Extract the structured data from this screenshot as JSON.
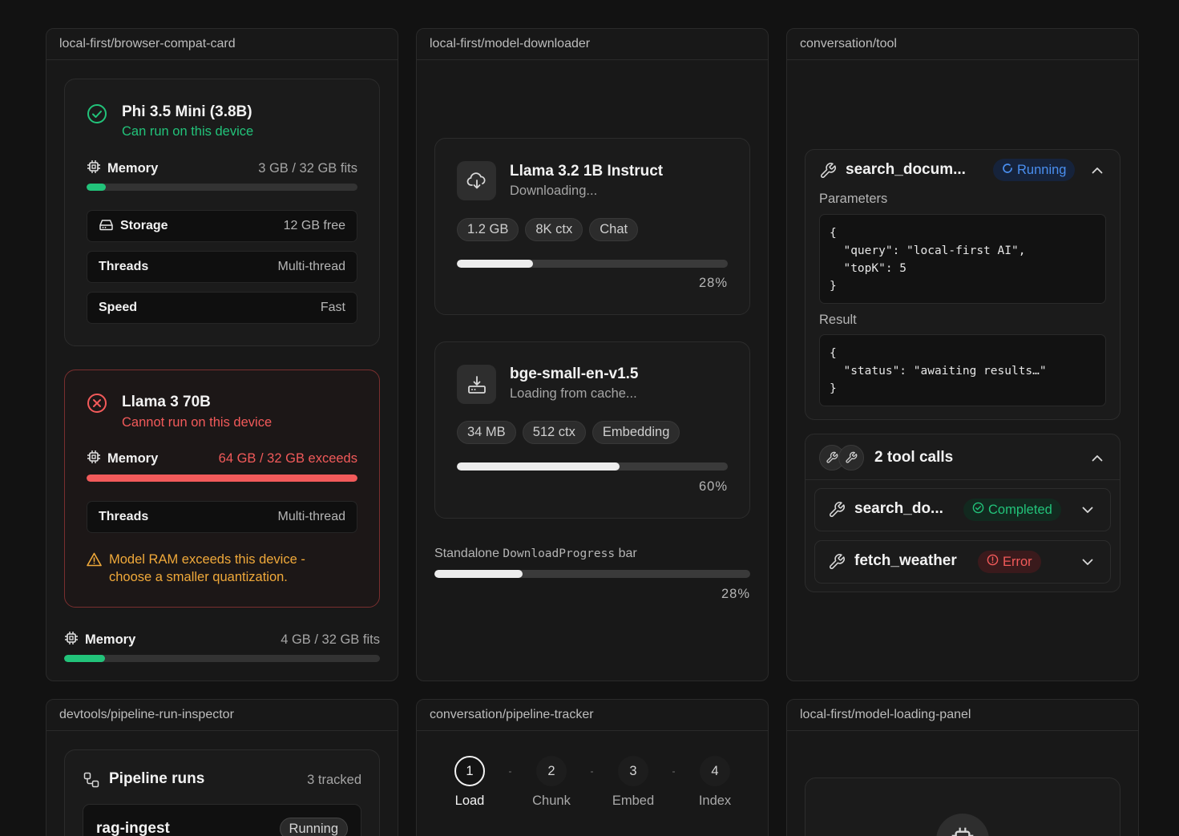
{
  "panels": {
    "compat": {
      "title": "local-first/browser-compat-card"
    },
    "downloader": {
      "title": "local-first/model-downloader"
    },
    "tool": {
      "title": "conversation/tool"
    },
    "pipeline_inspector": {
      "title": "devtools/pipeline-run-inspector"
    },
    "pipeline_tracker": {
      "title": "conversation/pipeline-tracker"
    },
    "loading_panel": {
      "title": "local-first/model-loading-panel"
    }
  },
  "compat_cards": [
    {
      "name": "Phi 3.5 Mini (3.8B)",
      "status": "Can run on this device",
      "memory_label": "Memory",
      "memory_value": "3 GB / 32 GB fits",
      "memory_fraction": 0.07,
      "rows": [
        {
          "label": "Storage",
          "value": "12 GB free"
        },
        {
          "label": "Threads",
          "value": "Multi-thread"
        },
        {
          "label": "Speed",
          "value": "Fast"
        }
      ]
    },
    {
      "name": "Llama 3 70B",
      "status": "Cannot run on this device",
      "memory_label": "Memory",
      "memory_value": "64 GB / 32 GB exceeds",
      "memory_fraction": 1.0,
      "rows": [
        {
          "label": "Threads",
          "value": "Multi-thread"
        }
      ],
      "warning": "Model RAM exceeds this device - choose a smaller quantization."
    }
  ],
  "standalone_memory": {
    "label": "Memory",
    "value": "4 GB / 32 GB fits",
    "fraction": 0.13
  },
  "downloads": [
    {
      "name": "Llama 3.2 1B Instruct",
      "status": "Downloading...",
      "tags": [
        "1.2 GB",
        "8K ctx",
        "Chat"
      ],
      "progress": 28,
      "progress_label": "28%",
      "icon": "cloud-download-icon"
    },
    {
      "name": "bge-small-en-v1.5",
      "status": "Loading from cache...",
      "tags": [
        "34 MB",
        "512 ctx",
        "Embedding"
      ],
      "progress": 60,
      "progress_label": "60%",
      "icon": "hard-drive-download-icon"
    }
  ],
  "standalone_progress": {
    "caption_prefix": "Standalone",
    "caption_code": "DownloadProgress",
    "caption_suffix": "bar",
    "progress": 28,
    "progress_label": "28%"
  },
  "tool_call": {
    "name": "search_docum...",
    "status": "Running",
    "params_label": "Parameters",
    "params_code": "{\n  \"query\": \"local-first AI\",\n  \"topK\": 5\n}",
    "result_label": "Result",
    "result_code": "{\n  \"status\": \"awaiting results…\"\n}"
  },
  "tool_group": {
    "title": "2 tool calls",
    "items": [
      {
        "name": "search_do...",
        "status": "Completed"
      },
      {
        "name": "fetch_weather",
        "status": "Error"
      }
    ]
  },
  "pipeline_runs": {
    "title": "Pipeline runs",
    "count": "3 tracked",
    "first_run": {
      "name": "rag-ingest",
      "status": "Running"
    }
  },
  "pipeline_steps": [
    {
      "num": "1",
      "label": "Load",
      "active": true
    },
    {
      "num": "2",
      "label": "Chunk",
      "active": false
    },
    {
      "num": "3",
      "label": "Embed",
      "active": false
    },
    {
      "num": "4",
      "label": "Index",
      "active": false
    }
  ],
  "colors": {
    "green": "#22c37a",
    "red": "#f25a5a",
    "blue": "#4a8ff0",
    "amber": "#f0a93a"
  }
}
